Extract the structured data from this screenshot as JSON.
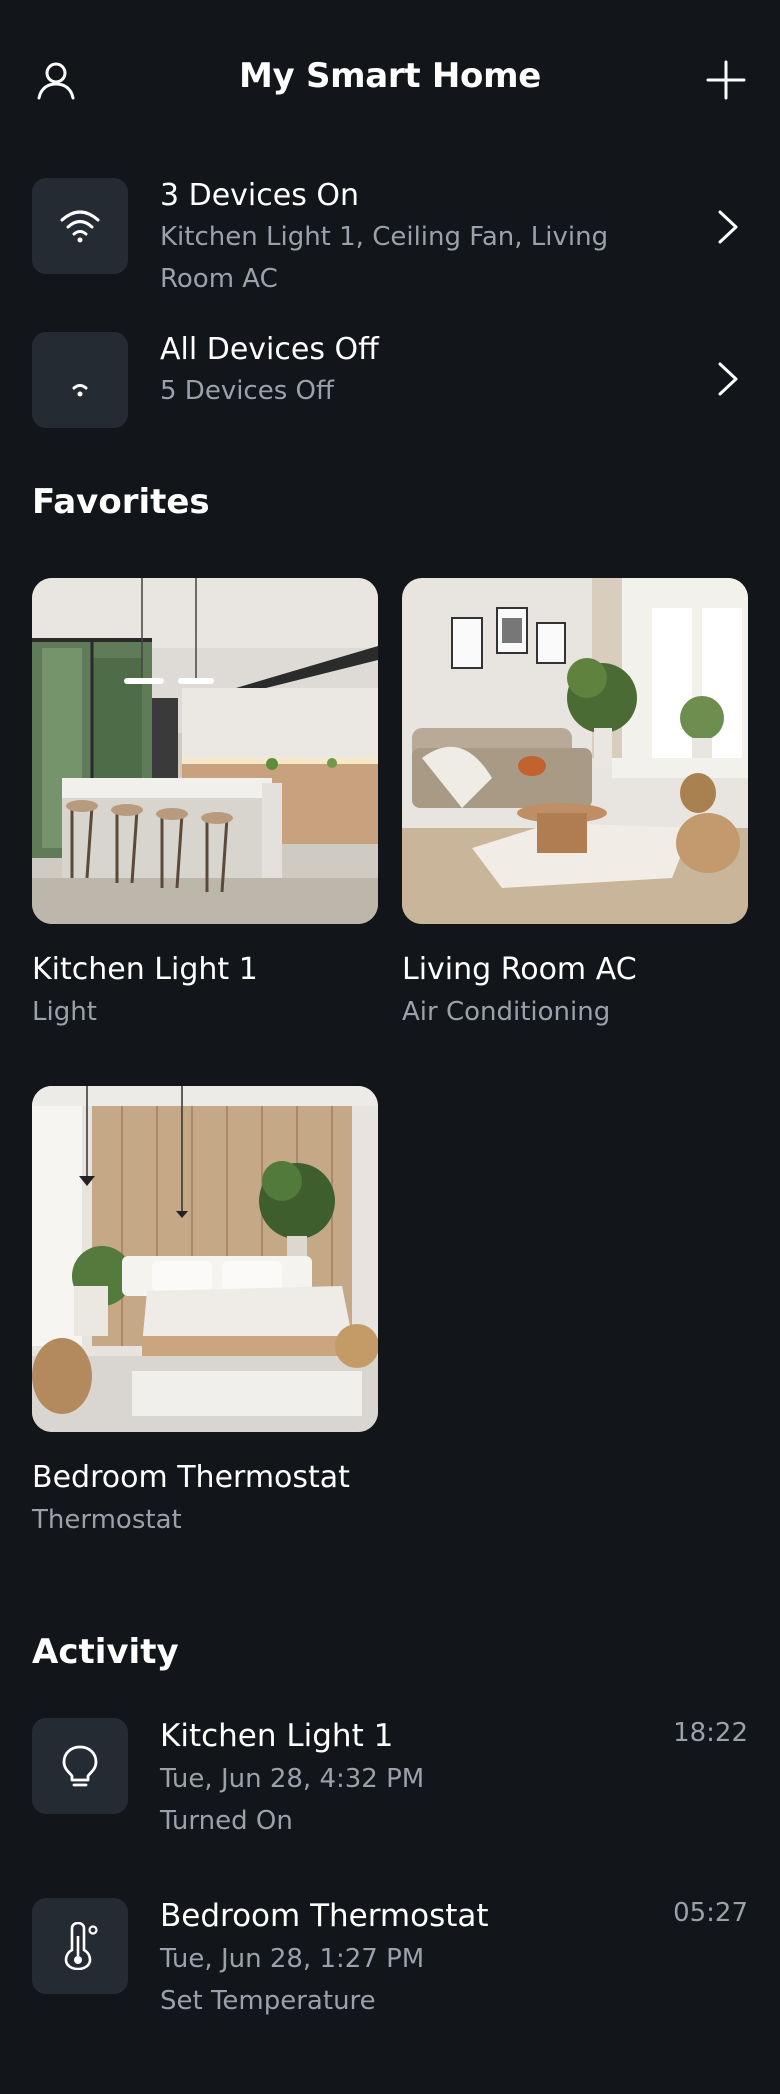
{
  "header": {
    "title": "My Smart Home",
    "profile_icon": "user-icon",
    "add_icon": "plus-icon"
  },
  "summary": [
    {
      "title": "3 Devices On",
      "subtitle": "Kitchen Light 1, Ceiling Fan, Living Room AC",
      "icon": "wifi-strong-icon"
    },
    {
      "title": "All Devices Off",
      "subtitle": "5 Devices Off",
      "icon": "wifi-weak-icon"
    }
  ],
  "favorites": {
    "title": "Favorites",
    "items": [
      {
        "name": "Kitchen Light 1",
        "type": "Light"
      },
      {
        "name": "Living Room AC",
        "type": "Air Conditioning"
      },
      {
        "name": "Bedroom Thermostat",
        "type": "Thermostat"
      }
    ]
  },
  "activity": {
    "title": "Activity",
    "items": [
      {
        "name": "Kitchen Light 1",
        "date": "Tue, Jun 28, 4:32 PM",
        "action": "Turned On",
        "time": "18:22",
        "icon": "lightbulb-icon"
      },
      {
        "name": "Bedroom Thermostat",
        "date": "Tue, Jun 28, 1:27 PM",
        "action": "Set Temperature",
        "time": "05:27",
        "icon": "thermometer-icon"
      }
    ]
  },
  "colors": {
    "background": "#121519",
    "tile": "#252b33",
    "secondary_text": "#9aa1ab"
  }
}
